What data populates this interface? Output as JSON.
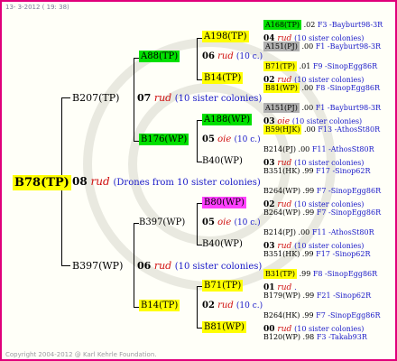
{
  "header": "13- 3-2012 ( 19: 38)",
  "footer": "Copyright 2004-2012 @ Karl Kehrle Foundation.",
  "root": {
    "name": "B78(TP)",
    "gen": "08",
    "rud": "rud",
    "note": "(Drones from 10 sister colonies)"
  },
  "level1": [
    {
      "name": "B207(TP)",
      "gen": "07",
      "rud": "rud",
      "note": "(10 sister colonies)"
    },
    {
      "name": "B397(WP)",
      "gen": "06",
      "rud": "rud",
      "note": "(10 sister colonies)"
    }
  ],
  "level2": [
    {
      "name": "A88(TP)",
      "gen": "06",
      "rud": "rud",
      "note": "(10 c.)"
    },
    {
      "name": "B176(WP)",
      "gen": "05",
      "rud": "oie",
      "note": "(10 c.)"
    },
    {
      "name": "B397(WP)",
      "gen": "05",
      "rud": "oie",
      "note": "(10 c.)"
    },
    {
      "name": "B14(TP)",
      "gen": "02",
      "rud": "rud",
      "note": "(10 c.)"
    }
  ],
  "level3": [
    {
      "name": "A198(TP)",
      "gen": "04",
      "rud": "rud",
      "note": "(10 sister colonies)"
    },
    {
      "name": "B14(TP)",
      "gen": "02",
      "rud": "rud",
      "note": "(10 sister colonies)"
    },
    {
      "name": "A188(WP)",
      "gen": "03",
      "rud": "oie",
      "note": "(10 sister colonies)"
    },
    {
      "name": "B40(WP)",
      "gen": "03",
      "rud": "rud",
      "note": "(10 sister colonies)"
    },
    {
      "name": "B80(WP)",
      "gen": "02",
      "rud": "rud",
      "note": "(10 sister colonies)"
    },
    {
      "name": "B40(WP)",
      "gen": "03",
      "rud": "rud",
      "note": "(10 sister colonies)"
    },
    {
      "name": "B71(TP)",
      "gen": "01",
      "rud": "rud",
      "note": "."
    },
    {
      "name": "B81(WP)",
      "gen": "00",
      "rud": "rud",
      "note": "(10 sister colonies)"
    }
  ],
  "level4": [
    {
      "name": "A168(TP)",
      "val": ".02",
      "line": "F3 -Bayburt98-3R"
    },
    {
      "name": "A151(PJ)",
      "val": ".00",
      "line": "F1 -Bayburt98-3R"
    },
    {
      "name": "B71(TP)",
      "val": ".01",
      "line": "F9 -SinopEgg86R"
    },
    {
      "name": "B81(WP)",
      "val": ".00",
      "line": "F8 -SinopEgg86R"
    },
    {
      "name": "A151(PJ)",
      "val": ".00",
      "line": "F1 -Bayburt98-3R"
    },
    {
      "name": "B59(HJK)",
      "val": ".00",
      "line": "F13 -AthosSt80R"
    },
    {
      "name": "B214(PJ)",
      "val": ".00",
      "line": "F11 -AthosSt80R"
    },
    {
      "name": "B351(HK)",
      "val": ".99",
      "line": "F17 -Sinop62R"
    },
    {
      "name": "B264(WP)",
      "val": ".99",
      "line": "F7 -SinopEgg86R"
    },
    {
      "name": "B264(WP)",
      "val": ".99",
      "line": "F7 -SinopEgg86R"
    },
    {
      "name": "B214(PJ)",
      "val": ".00",
      "line": "F11 -AthosSt80R"
    },
    {
      "name": "B351(HK)",
      "val": ".99",
      "line": "F17 -Sinop62R"
    },
    {
      "name": "B31(TP)",
      "val": ".99",
      "line": "F8 -SinopEgg86R"
    },
    {
      "name": "B179(WP)",
      "val": ".99",
      "line": "F21 -Sinop62R"
    },
    {
      "name": "B264(HK)",
      "val": ".99",
      "line": "F7 -SinopEgg86R"
    },
    {
      "name": "B120(WP)",
      "val": ".98",
      "line": "F3 -Takab93R"
    }
  ],
  "colors": {
    "frame": "#e0007a",
    "yellow": "#ffff00",
    "green": "#00e000",
    "gray": "#b0b0b0",
    "magenta": "#ff40ff",
    "red": "#d01010",
    "blue": "#1818c8"
  }
}
